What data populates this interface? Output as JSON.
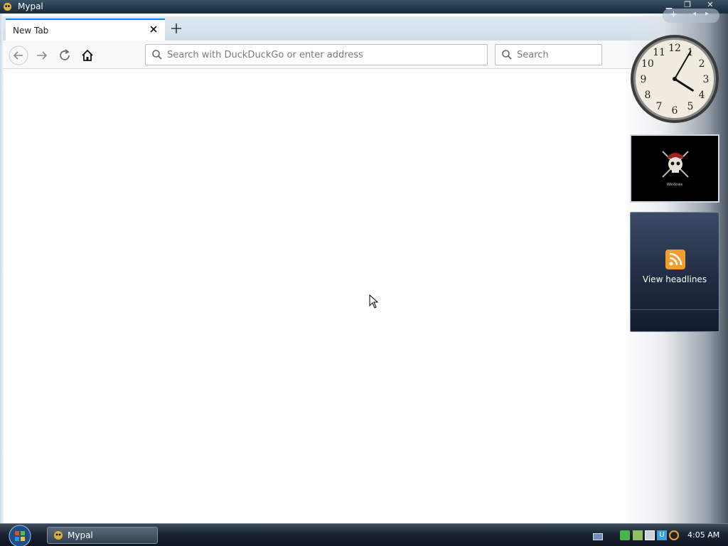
{
  "window": {
    "title": "Mypal"
  },
  "tabs": [
    {
      "label": "New Tab",
      "active": true
    }
  ],
  "navbar": {
    "url_placeholder": "Search with DuckDuckGo or enter address",
    "search_placeholder": "Search"
  },
  "sidebar": {
    "clock": {
      "hour": 4,
      "minute": 5
    },
    "feed": {
      "label": "View headlines"
    },
    "slideshow": {
      "caption": "Windows"
    }
  },
  "taskbar": {
    "window_button": "Mypal",
    "clock": "4:05 AM"
  },
  "colors": {
    "tab_accent": "#0a84ff",
    "rss": "#f39d2c"
  }
}
